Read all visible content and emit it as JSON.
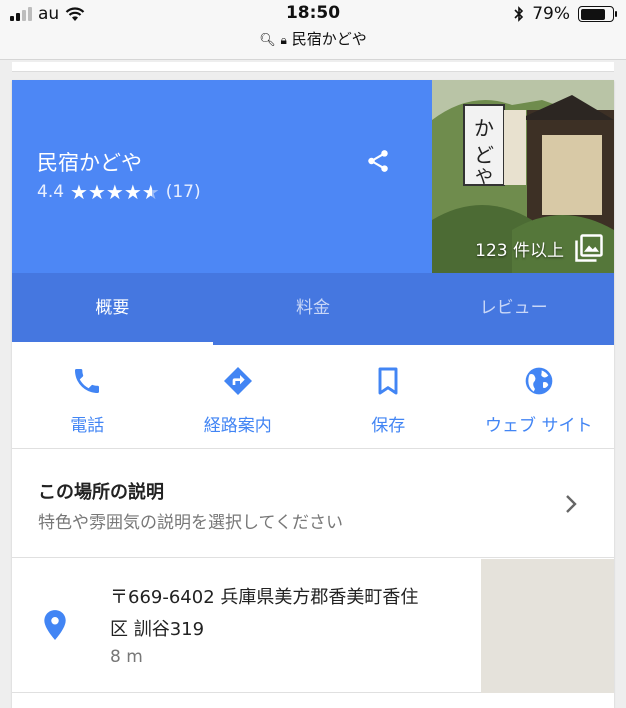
{
  "status_bar": {
    "carrier": "au",
    "time": "18:50",
    "url": "民宿かどや",
    "battery": "79%",
    "battery_level": 0.79
  },
  "place": {
    "name": "民宿かどや",
    "rating": "4.4",
    "rating_value": 4.4,
    "review_count": "(17)",
    "photo_count": "123 件以上"
  },
  "tabs": [
    {
      "label": "概要"
    },
    {
      "label": "料金"
    },
    {
      "label": "レビュー"
    }
  ],
  "actions": [
    {
      "label": "電話",
      "icon": "phone-icon"
    },
    {
      "label": "経路案内",
      "icon": "directions-icon"
    },
    {
      "label": "保存",
      "icon": "bookmark-icon"
    },
    {
      "label": "ウェブ サイト",
      "icon": "globe-icon"
    }
  ],
  "description": {
    "title": "この場所の説明",
    "subtitle": "特色や雰囲気の説明を選択してください"
  },
  "address": {
    "line1": "〒669-6402 兵庫県美方郡香美町香住",
    "line2": "区 訓谷319",
    "distance": "8 m"
  },
  "colors": {
    "header": "#4d87f5",
    "tabs": "#4577e0",
    "accent": "#4285f4"
  }
}
